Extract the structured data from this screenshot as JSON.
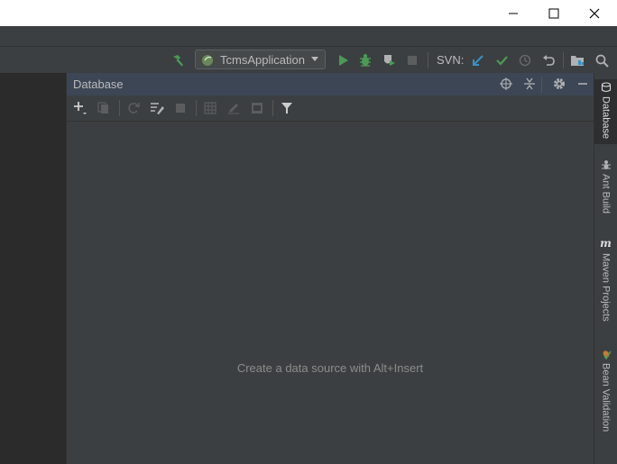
{
  "window": {
    "controls": {
      "minimize": "minimize",
      "maximize": "maximize",
      "close": "close"
    }
  },
  "toolbar": {
    "run_configuration": "TcmsApplication",
    "svn_label": "SVN:",
    "icons": [
      "build-hammer-icon",
      "run-icon",
      "debug-icon",
      "coverage-icon",
      "stop-icon",
      "svn-update-icon",
      "svn-commit-icon",
      "history-icon",
      "revert-icon",
      "project-structure-icon",
      "search-icon"
    ]
  },
  "database_panel": {
    "title": "Database",
    "empty_text": "Create a data source with Alt+Insert",
    "header_icons": [
      "target-icon",
      "collapse-icon",
      "gear-icon",
      "hide-icon"
    ],
    "toolbar_icons": [
      "add-icon",
      "copy-icon",
      "refresh-icon",
      "schema-edit-icon",
      "stop-icon",
      "table-icon",
      "edit-icon",
      "console-icon",
      "filter-icon"
    ]
  },
  "right_tool_strip": {
    "tabs": [
      {
        "label": "Database",
        "icon": "database-icon",
        "active": true
      },
      {
        "label": "Ant Build",
        "icon": "ant-icon",
        "active": false
      },
      {
        "label": "Maven Projects",
        "icon": "maven-icon",
        "active": false
      },
      {
        "label": "Bean Validation",
        "icon": "bean-validation-icon",
        "active": false
      }
    ]
  },
  "colors": {
    "accent_green": "#499c54",
    "svn_blue": "#3592c4",
    "panel_header": "#3c4655",
    "panel_bg": "#3c3f41"
  }
}
